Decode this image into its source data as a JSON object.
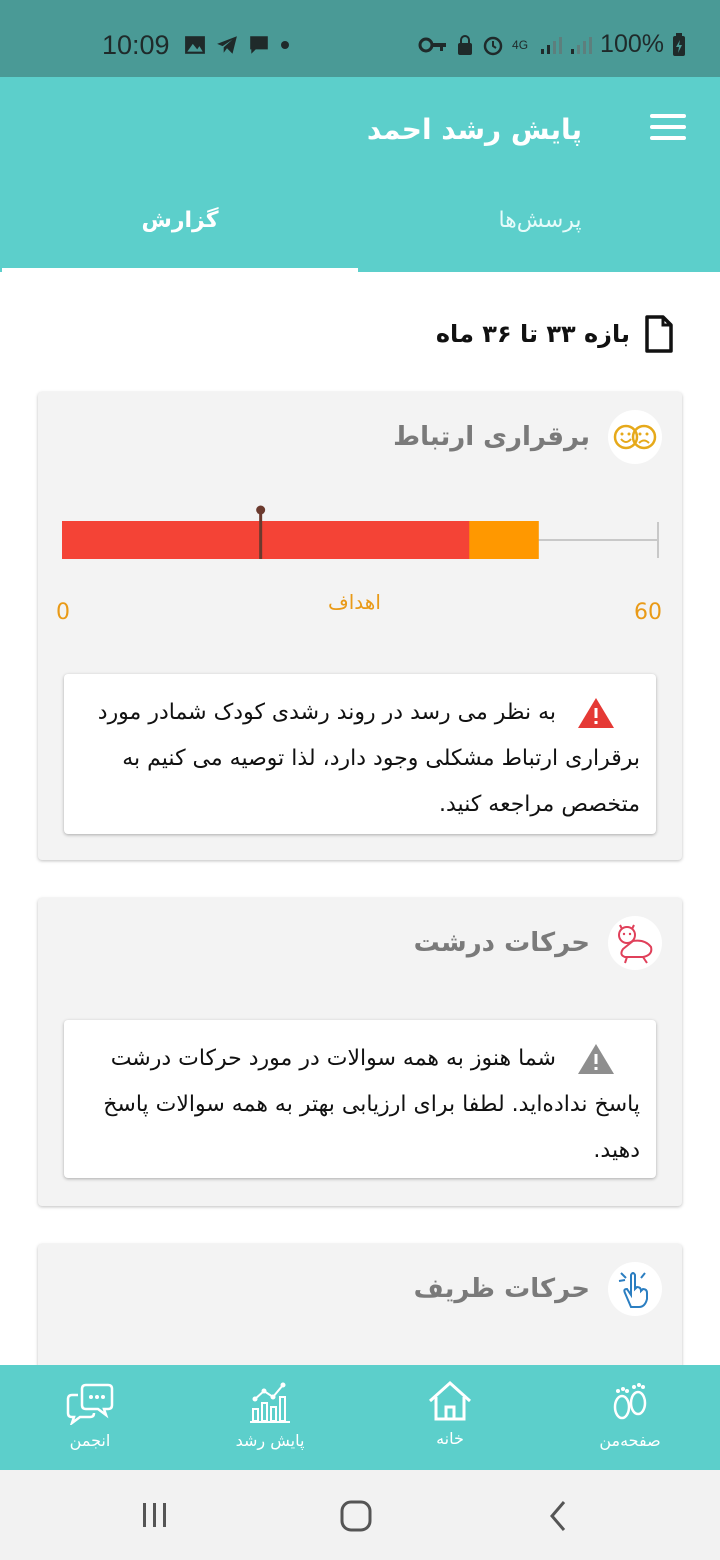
{
  "status_bar": {
    "time": "10:09",
    "battery": "100%",
    "network": "4G"
  },
  "app_bar": {
    "title": "پایش رشد احمد",
    "menu_icon": "hamburger-menu-icon"
  },
  "tabs": [
    {
      "label": "گزارش",
      "selected": true
    },
    {
      "label": "پرسش‌ها",
      "selected": false
    }
  ],
  "period": {
    "label": "بازه ۳۳ تا ۳۶ ماه",
    "icon": "document-icon"
  },
  "cards": [
    {
      "title": "برقراری ارتباط",
      "icon": "faces-icon",
      "gauge": {
        "min": "0",
        "max": "60",
        "label": "اهداف",
        "red_end": 41,
        "orange_end": 48,
        "marker": 20
      },
      "alert": {
        "icon": "warning-red-icon",
        "text": "به نظر می رسد در روند رشدی کودک شمادر مورد  برقراری ارتباط مشکلی وجود دارد، لذا توصیه می کنیم به متخصص مراجعه کنید."
      }
    },
    {
      "title": "حرکات درشت",
      "icon": "crawling-baby-icon",
      "alert": {
        "icon": "warning-gray-icon",
        "text": "شما هنوز به همه سوالات در مورد حرکات درشت پاسخ نداده‌اید. لطفا برای ارزیابی بهتر به همه سوالات پاسخ دهید."
      }
    },
    {
      "title": "حرکات ظریف",
      "icon": "hand-gesture-icon"
    }
  ],
  "bottom_nav": [
    {
      "label": "صفحه‌من",
      "icon": "footprints-icon"
    },
    {
      "label": "خانه",
      "icon": "home-icon"
    },
    {
      "label": "پایش رشد",
      "icon": "growth-chart-icon"
    },
    {
      "label": "انجمن",
      "icon": "chat-bubbles-icon"
    }
  ],
  "colors": {
    "primary": "#5ccfcb",
    "status_bar": "#4a9a96",
    "gauge_red": "#f44336",
    "gauge_orange": "#ff9800",
    "accent_text": "#e99a17"
  }
}
